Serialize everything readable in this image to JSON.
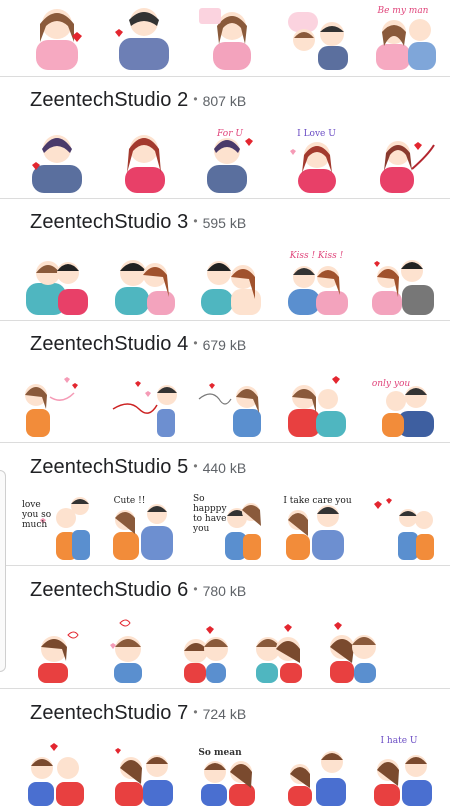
{
  "packs": [
    {
      "name": "ZeentechStudio 2",
      "size": "807 kB",
      "captions": [
        "",
        "",
        "For U",
        "I Love U",
        ""
      ]
    },
    {
      "name": "ZeentechStudio 3",
      "size": "595 kB",
      "captions": [
        "",
        "",
        "",
        "Kiss ! Kiss !",
        ""
      ]
    },
    {
      "name": "ZeentechStudio 4",
      "size": "679 kB",
      "captions": [
        "",
        "",
        "",
        "",
        "only you"
      ]
    },
    {
      "name": "ZeentechStudio 5",
      "size": "440 kB",
      "captions": [
        "love you so much",
        "Cute !!",
        "So happpy to have you",
        "I take care you",
        ""
      ]
    },
    {
      "name": "ZeentechStudio 6",
      "size": "780 kB",
      "captions": [
        "",
        "",
        "",
        "",
        ""
      ]
    },
    {
      "name": "ZeentechStudio 7",
      "size": "724 kB",
      "captions": [
        "",
        "",
        "So mean",
        "",
        "I hate U"
      ]
    }
  ],
  "top_row_captions": [
    "",
    "",
    "",
    "",
    "Be my man"
  ],
  "separator": "•"
}
